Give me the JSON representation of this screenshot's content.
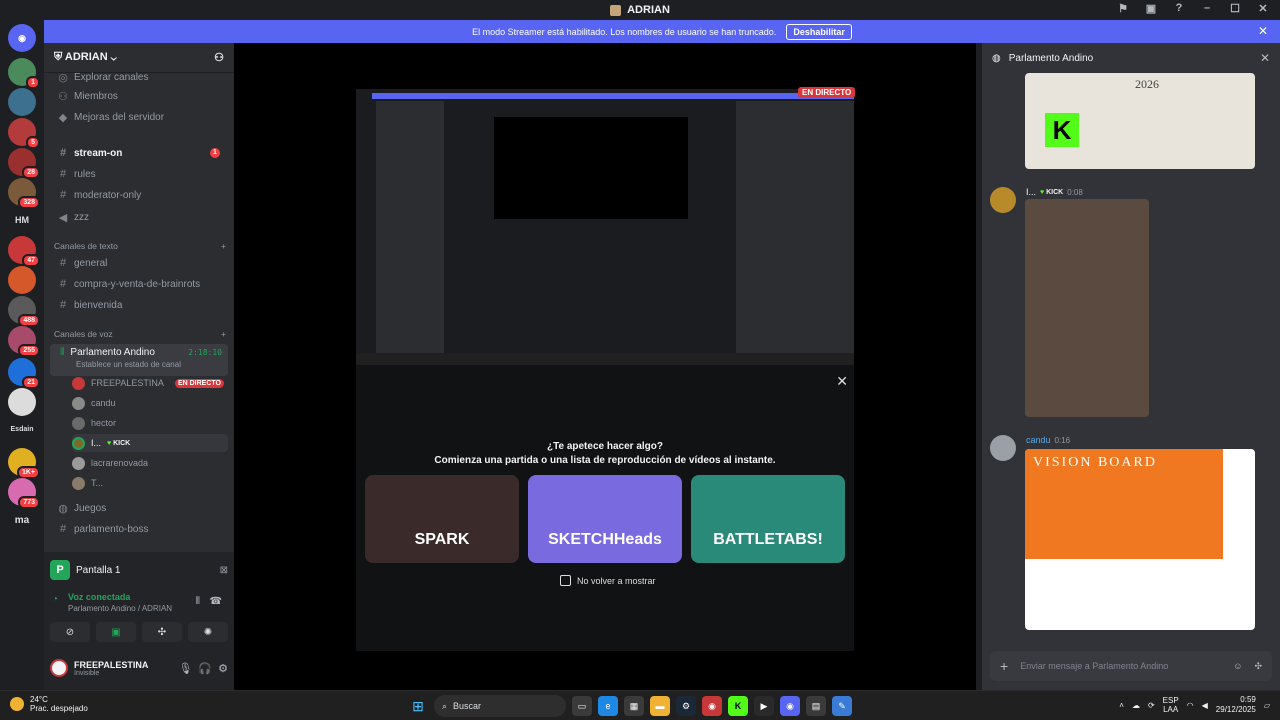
{
  "window": {
    "title": "ADRIAN"
  },
  "banner": {
    "text": "El modo Streamer está habilitado. Los nombres de usuario se han truncado.",
    "button": "Deshabilitar"
  },
  "guilds": [
    {
      "badge": "1"
    },
    {
      "badge": ""
    },
    {
      "badge": "5"
    },
    {
      "badge": "28"
    },
    {
      "badge": "328"
    },
    {
      "label": "HM",
      "badge": ""
    },
    {
      "badge": "47"
    },
    {
      "badge": ""
    },
    {
      "badge": "488"
    },
    {
      "badge": "255"
    },
    {
      "badge": "21"
    },
    {
      "badge": ""
    },
    {
      "label": "Esdain",
      "badge": ""
    },
    {
      "badge": "1K+"
    },
    {
      "badge": "773"
    },
    {
      "label": "ma",
      "badge": ""
    }
  ],
  "sidebar": {
    "server_name": "ADRIAN",
    "top_items": [
      "Explorar canales",
      "Miembros",
      "Mejoras del servidor"
    ],
    "channels_top": [
      "stream-on",
      "rules",
      "moderator-only",
      "zzz"
    ],
    "stream_on_unread": "1",
    "text_category": "Canales de texto",
    "text_channels": [
      "general",
      "compra-y-venta-de-brainrots",
      "bienvenida"
    ],
    "voice_category": "Canales de voz",
    "voice_channel": {
      "name": "Parlamento Andino",
      "time": "2:18:10",
      "status": "Establece un estado de canal"
    },
    "voice_users": [
      "FREEPALESTINA",
      "candu",
      "hector",
      "I...",
      "lacrarenovada",
      "T..."
    ],
    "live_label": "EN DIRECTO",
    "kick_label": "KICK",
    "after_channels": [
      "Juegos",
      "parlamento-boss"
    ]
  },
  "panel": {
    "screen": "Pantalla 1",
    "voice_title": "Voz conectada",
    "voice_sub": "Parlamento Andino / ADRIAN",
    "user_name": "FREEPALESTINA",
    "user_status": "Invisible"
  },
  "stage": {
    "live_tag": "EN DIRECTO",
    "activity_question": "¿Te apetece hacer algo?",
    "activity_sub": "Comienza una partida o una lista de reproducción de vídeos al instante.",
    "cards": [
      "SPARK",
      "SKETCHHeads",
      "BATTLETABS!"
    ],
    "dont_show": "No volver a mostrar"
  },
  "chat": {
    "title": "Parlamento Andino",
    "msg1_author": "I...",
    "msg1_kick": "KICK",
    "msg1_time": "0:08",
    "msg2_author": "candu",
    "msg2_time": "0:16",
    "board_text": "VISION BOARD",
    "collage_year": "2026",
    "input_placeholder": "Enviar mensaje a Parlamento Andino"
  },
  "taskbar": {
    "temp": "24°C",
    "weather": "Prac. despejado",
    "search": "Buscar",
    "lang1": "ESP",
    "lang2": "LAA",
    "time": "0:59",
    "date": "29/12/2025"
  },
  "colors": {
    "accent": "#5865f2",
    "live": "#da373c",
    "online": "#23a55a",
    "kick": "#53fc18"
  }
}
